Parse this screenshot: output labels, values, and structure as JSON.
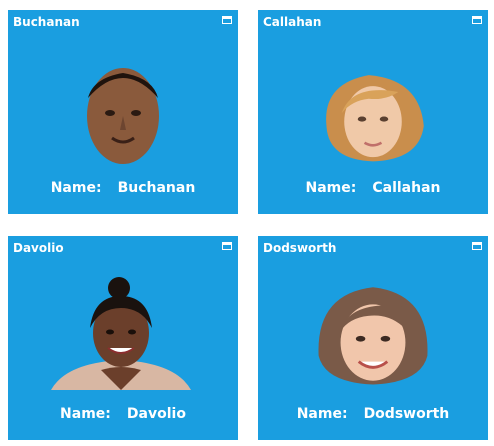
{
  "theme": {
    "tile": "#1a9ee0"
  },
  "cards": [
    {
      "title": "Buchanan",
      "name_label": "Name:",
      "name_value": "Buchanan",
      "portrait": "man-short-hair-portrait"
    },
    {
      "title": "Callahan",
      "name_label": "Name:",
      "name_value": "Callahan",
      "portrait": "woman-blonde-wavy-portrait"
    },
    {
      "title": "Davolio",
      "name_label": "Name:",
      "name_value": "Davolio",
      "portrait": "woman-dark-hair-bun-portrait"
    },
    {
      "title": "Dodsworth",
      "name_label": "Name:",
      "name_value": "Dodsworth",
      "portrait": "woman-brown-bob-portrait"
    }
  ],
  "icons": {
    "maximize": "maximize-icon"
  }
}
